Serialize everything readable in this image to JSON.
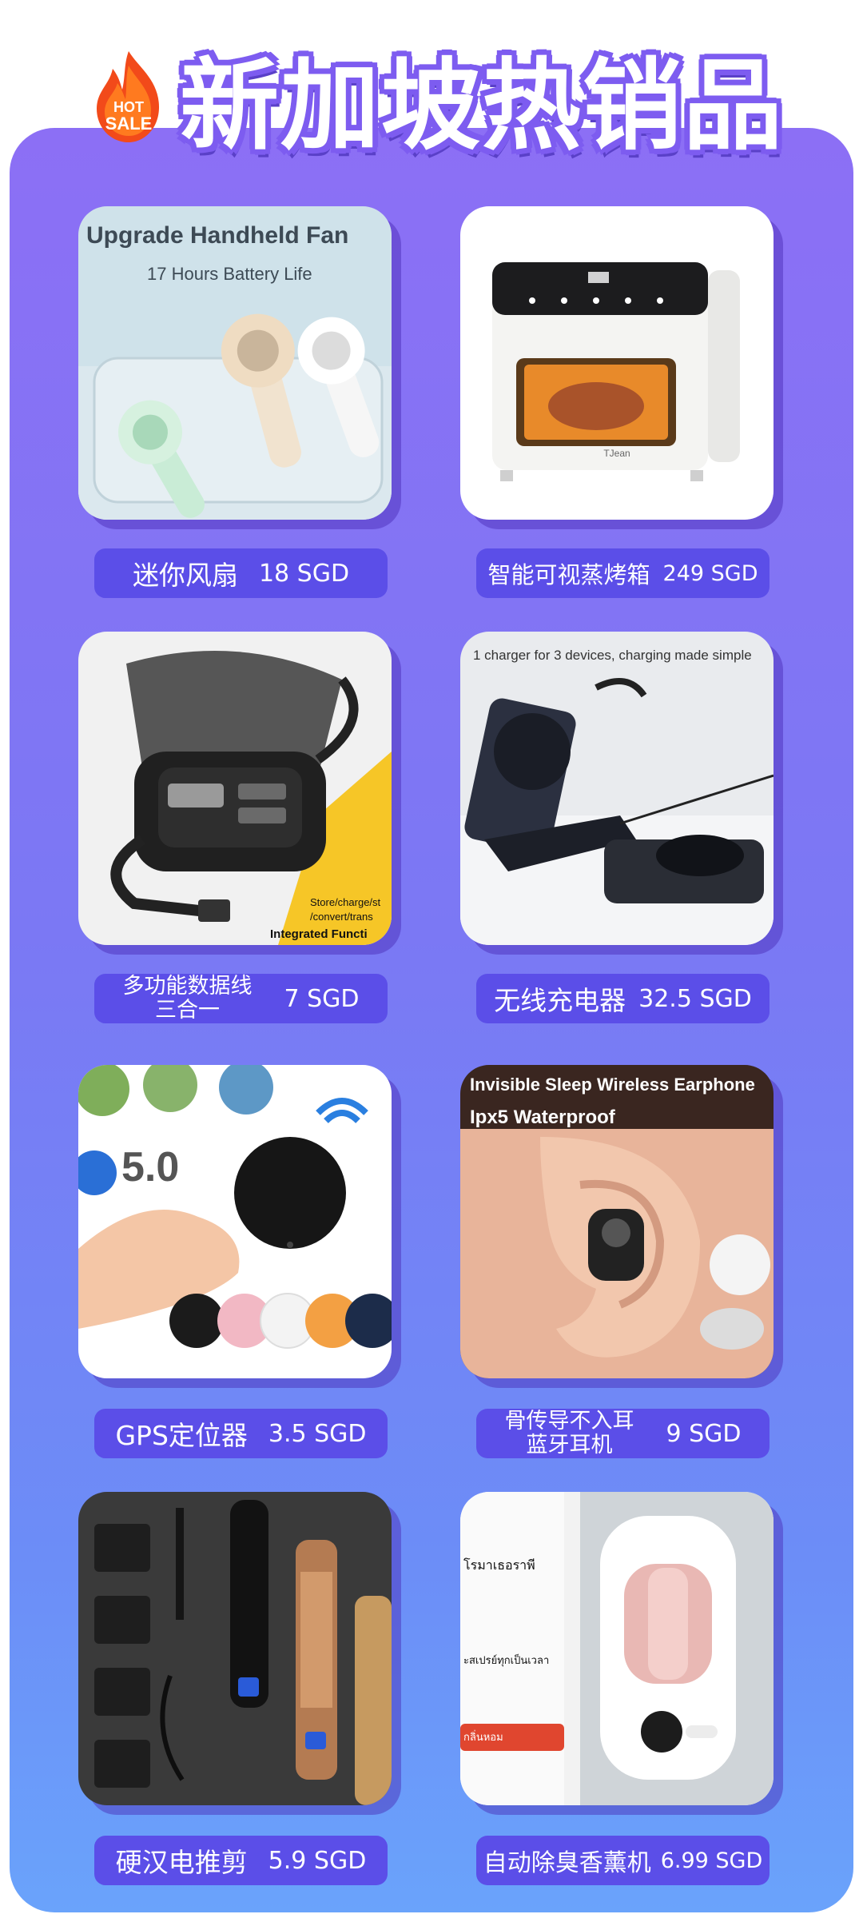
{
  "header": {
    "title": "新加坡热销品",
    "badge_top": "HOT",
    "badge_bottom": "SALE"
  },
  "colors": {
    "panel_top": "#8c6ff5",
    "panel_bottom": "#6aa3fb",
    "label_bg": "#5b4ee8"
  },
  "products": [
    {
      "name": "迷你风扇",
      "price": "18 SGD",
      "image_text": [
        "Upgrade Handheld Fan",
        "17 Hours Battery Life"
      ]
    },
    {
      "name": "智能可视蒸烤箱",
      "price": "249 SGD",
      "image_text": [
        "TJean"
      ]
    },
    {
      "name": "多功能数据线\n三合一",
      "price": "7 SGD",
      "image_text": [
        "Store/charge/st",
        "/convert/trans",
        "Integrated Functi"
      ]
    },
    {
      "name": "无线充电器",
      "price": "32.5 SGD",
      "image_text": [
        "1 charger for 3 devices, charging made simple"
      ]
    },
    {
      "name": "GPS定位器",
      "price": "3.5 SGD",
      "image_text": [
        "5.0"
      ]
    },
    {
      "name": "骨传导不入耳\n蓝牙耳机",
      "price": "9 SGD",
      "image_text": [
        "Invisible Sleep Wireless Earphone",
        "Ipx5 Waterproof"
      ]
    },
    {
      "name": "硬汉电推剪",
      "price": "5.9 SGD",
      "image_text": []
    },
    {
      "name": "自动除臭香薰机",
      "price": "6.99 SGD",
      "image_text": [
        "โรมาเธอราพี",
        "ะสเปรย์ทุกเป็นเวลา",
        "กลิ่นหอม"
      ]
    }
  ]
}
